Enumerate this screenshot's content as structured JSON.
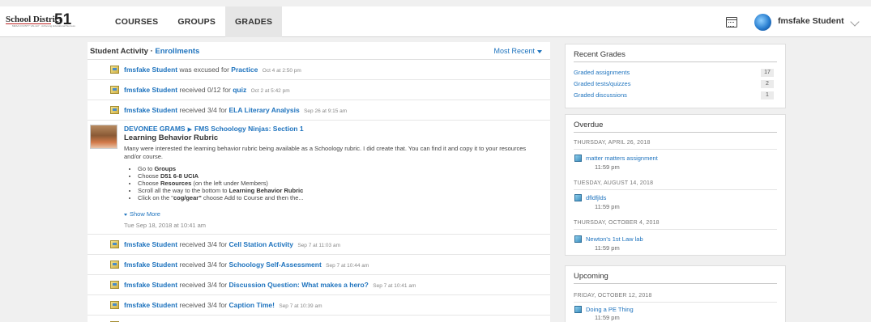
{
  "header": {
    "logo_text": "School District",
    "logo_number": "51",
    "logo_sub": "MESA COUNTY VALLEY · Achieving Educational Success",
    "nav": [
      "COURSES",
      "GROUPS",
      "GRADES"
    ],
    "active_nav": "GRADES",
    "user_name": "fmsfake Student"
  },
  "activity": {
    "title": "Student Activity",
    "separator": "·",
    "enrollments_link": "Enrollments",
    "sort_label": "Most Recent",
    "rows_top": [
      {
        "name": "fmsfake Student",
        "action": "was excused for",
        "item": "Practice",
        "time": "Oct 4 at 2:50 pm"
      },
      {
        "name": "fmsfake Student",
        "action": "received 0/12 for",
        "item": "quiz",
        "time": "Oct 2 at 5:42 pm"
      },
      {
        "name": "fmsfake Student",
        "action": "received 3/4 for",
        "item": "ELA Literary Analysis",
        "time": "Sep 26 at 9:15 am"
      }
    ],
    "post": {
      "author": "DEVONEE GRAMS",
      "group": "FMS Schoology Ninjas: Section 1",
      "title": "Learning Behavior Rubric",
      "body": "Many were interested the learning behavior rubric being available as a Schoology rubric.  I did create that.  You can find it and copy it to your resources and/or course.",
      "list": [
        {
          "pre": "Go to ",
          "bold": "Groups",
          "post": ""
        },
        {
          "pre": "Choose ",
          "bold": "D51 6-8 UCIA",
          "post": ""
        },
        {
          "pre": "Choose ",
          "bold": "Resources",
          "post": " (on the left under Members)"
        },
        {
          "pre": "Scroll all the way to the bottom to ",
          "bold": "Learning Behavior Rubric",
          "post": ""
        },
        {
          "pre": "Click on the \"",
          "bold": "cog/gear\"",
          "post": " choose Add to Course and then the..."
        }
      ],
      "show_more": "Show More",
      "date": "Tue Sep 18, 2018 at 10:41 am"
    },
    "rows_bottom": [
      {
        "name": "fmsfake Student",
        "action": "received 3/4 for",
        "item": "Cell Station Activity",
        "time": "Sep 7 at 11:03 am"
      },
      {
        "name": "fmsfake Student",
        "action": "received 3/4 for",
        "item": "Schoology Self-Assessment",
        "time": "Sep 7 at 10:44 am"
      },
      {
        "name": "fmsfake Student",
        "action": "received 3/4 for",
        "item": "Discussion Question: What makes a hero?",
        "time": "Sep 7 at 10:41 am"
      },
      {
        "name": "fmsfake Student",
        "action": "received 3/4 for",
        "item": "Caption Time!",
        "time": "Sep 7 at 10:39 am"
      }
    ]
  },
  "recent_grades": {
    "title": "Recent Grades",
    "rows": [
      {
        "label": "Graded assignments",
        "count": "17"
      },
      {
        "label": "Graded tests/quizzes",
        "count": "2"
      },
      {
        "label": "Graded discussions",
        "count": "1"
      }
    ]
  },
  "overdue": {
    "title": "Overdue",
    "groups": [
      {
        "day": "THURSDAY, APRIL 26, 2018",
        "task": "matter matters assignment",
        "time": "11:59 pm"
      },
      {
        "day": "TUESDAY, AUGUST 14, 2018",
        "task": "dfldfjlds",
        "time": "11:59 pm"
      },
      {
        "day": "THURSDAY, OCTOBER 4, 2018",
        "task": "Newton's 1st Law lab",
        "time": "11:59 pm"
      }
    ]
  },
  "upcoming": {
    "title": "Upcoming",
    "groups": [
      {
        "day": "FRIDAY, OCTOBER 12, 2018",
        "task": "Doing a PE Thing",
        "time": "11:59 pm"
      }
    ]
  }
}
